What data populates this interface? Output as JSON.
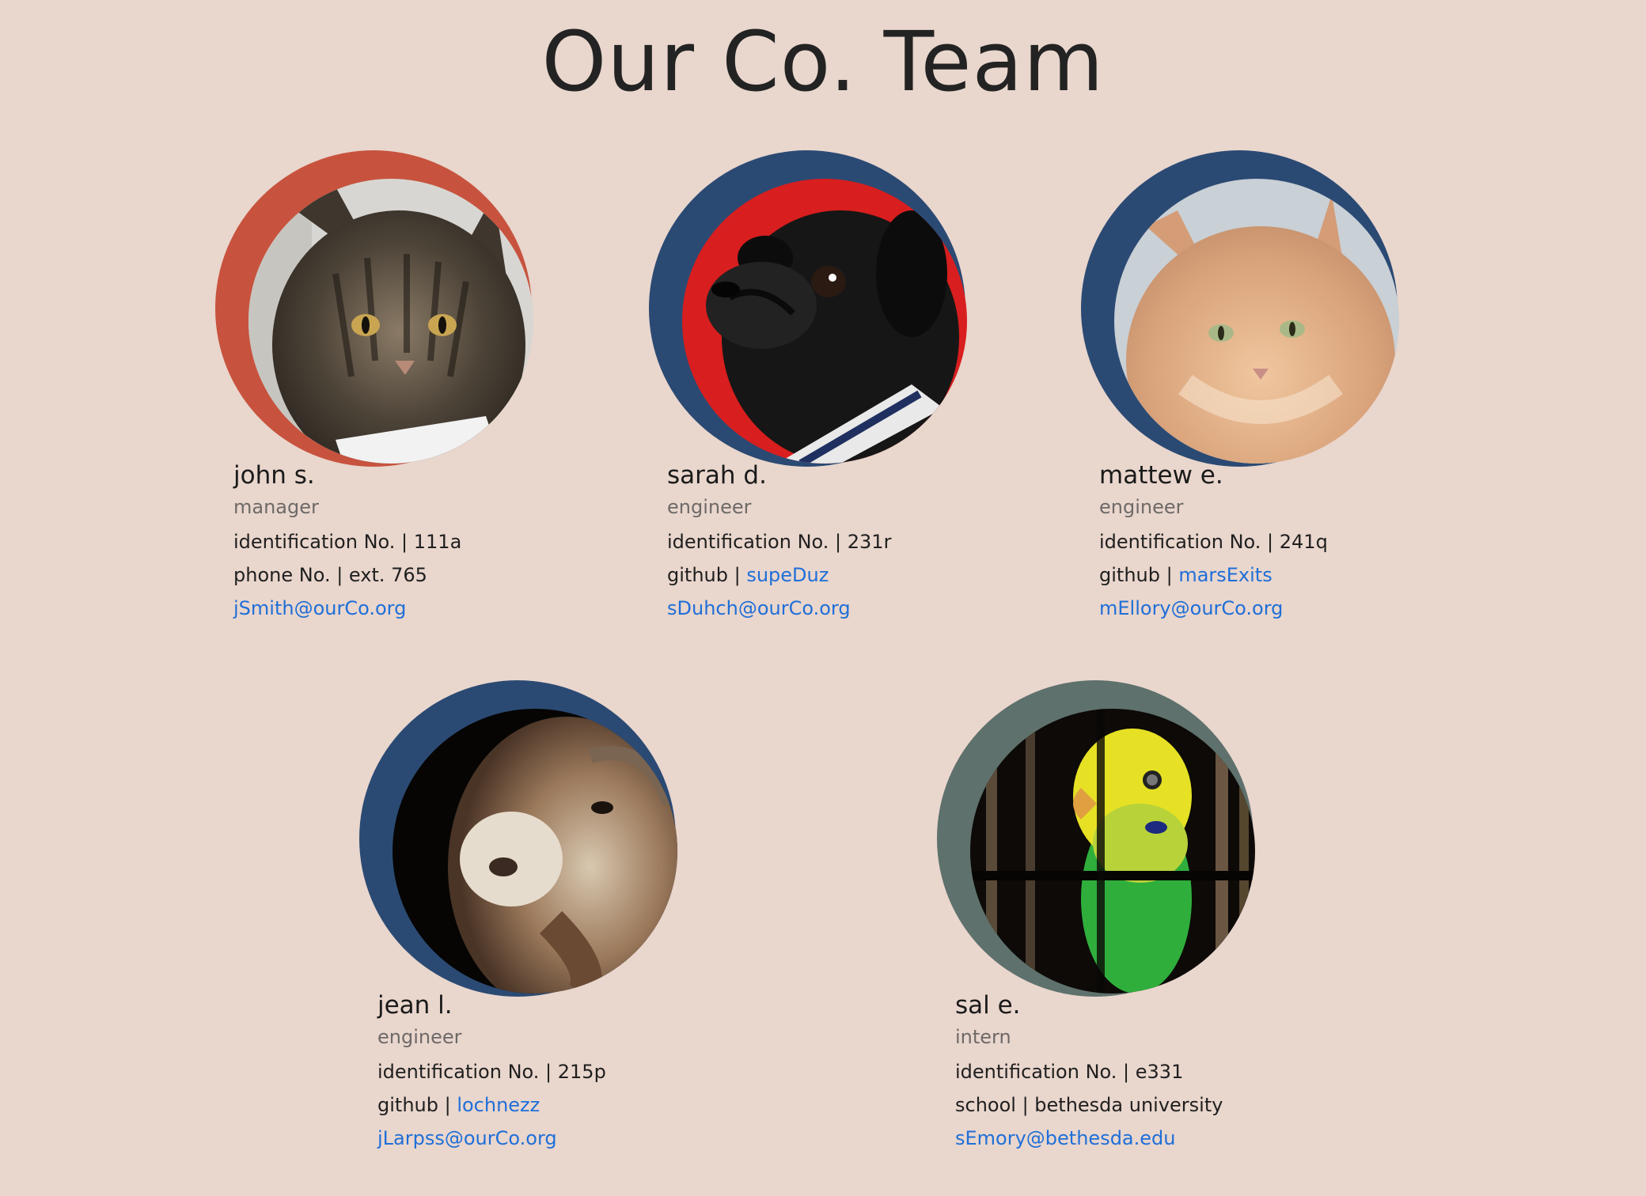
{
  "page": {
    "title": "Our Co. Team"
  },
  "colors": {
    "background": "#e9d6cd",
    "ring_red": "#c7533e",
    "ring_blue": "#2b4a73",
    "ring_gray": "#5e716c",
    "link": "#1f6fd8"
  },
  "members": [
    {
      "name": "john s.",
      "role": "manager",
      "line1": "identification No. | 111a",
      "line2_label": "phone No. | ext. 765",
      "line2_link": "",
      "email": "jSmith@ourCo.org",
      "ring_color": "#c7533e",
      "photo": "tabby-cat-photo"
    },
    {
      "name": "sarah d.",
      "role": "engineer",
      "line1": "identification No. | 231r",
      "line2_label": "github | ",
      "line2_link": "supeDuz",
      "email": "sDuhch@ourCo.org",
      "ring_color": "#2b4a73",
      "photo": "pug-dog-photo"
    },
    {
      "name": "mattew e.",
      "role": "engineer",
      "line1": "identification No. | 241q",
      "line2_label": "github | ",
      "line2_link": "marsExits",
      "email": "mEllory@ourCo.org",
      "ring_color": "#2b4a73",
      "photo": "orange-cat-photo"
    },
    {
      "name": "jean l.",
      "role": "engineer",
      "line1": "identification No. | 215p",
      "line2_label": "github | ",
      "line2_link": "lochnezz",
      "email": "jLarpss@ourCo.org",
      "ring_color": "#2b4a73",
      "photo": "goat-photo"
    },
    {
      "name": "sal e.",
      "role": "intern",
      "line1": "identification No. | e331",
      "line2_label": "school | bethesda university",
      "line2_link": "",
      "email": "sEmory@bethesda.edu",
      "ring_color": "#5e716c",
      "photo": "parakeet-photo"
    }
  ]
}
